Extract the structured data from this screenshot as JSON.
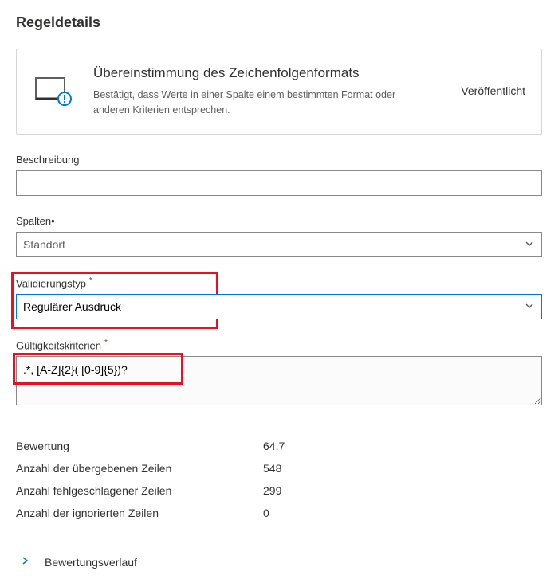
{
  "title": "Regeldetails",
  "card": {
    "title": "Übereinstimmung des Zeichenfolgenformats",
    "desc": "Bestätigt, dass Werte in einer Spalte einem bestimmten Format oder anderen Kriterien entsprechen.",
    "status": "Veröffentlicht"
  },
  "fields": {
    "description_label": "Beschreibung",
    "description_value": "",
    "columns_label": "Spalten",
    "columns_value": "Standort",
    "validation_type_label": "Validierungstyp",
    "validation_type_value": "Regulärer Ausdruck",
    "criteria_label": "Gültigkeitskriterien",
    "criteria_value": ".*, [A-Z]{2}( [0-9]{5})?"
  },
  "metrics": {
    "items": [
      {
        "label": "Bewertung",
        "value": "64.7"
      },
      {
        "label": "Anzahl der übergebenen Zeilen",
        "value": "548"
      },
      {
        "label": "Anzahl fehlgeschlagener Zeilen",
        "value": "299"
      },
      {
        "label": "Anzahl der ignorierten Zeilen",
        "value": "0"
      }
    ]
  },
  "history_label": "Bewertungsverlauf"
}
